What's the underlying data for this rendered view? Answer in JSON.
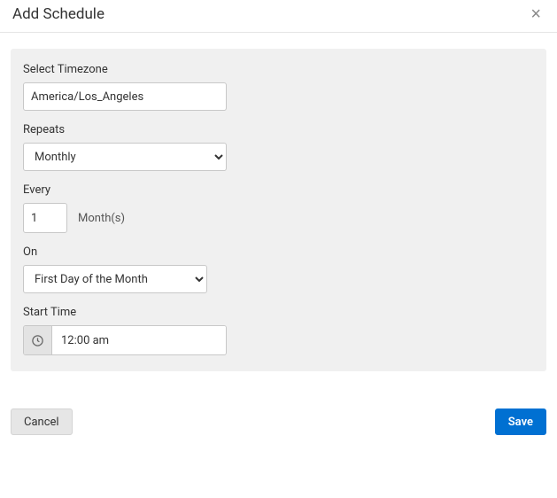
{
  "header": {
    "title": "Add Schedule",
    "close_glyph": "×"
  },
  "form": {
    "timezone": {
      "label": "Select Timezone",
      "value": "America/Los_Angeles"
    },
    "repeats": {
      "label": "Repeats",
      "value": "Monthly"
    },
    "every": {
      "label": "Every",
      "value": "1",
      "unit": "Month(s)"
    },
    "on": {
      "label": "On",
      "value": "First Day of the Month"
    },
    "start_time": {
      "label": "Start Time",
      "value": "12:00 am"
    }
  },
  "footer": {
    "cancel": "Cancel",
    "save": "Save"
  }
}
